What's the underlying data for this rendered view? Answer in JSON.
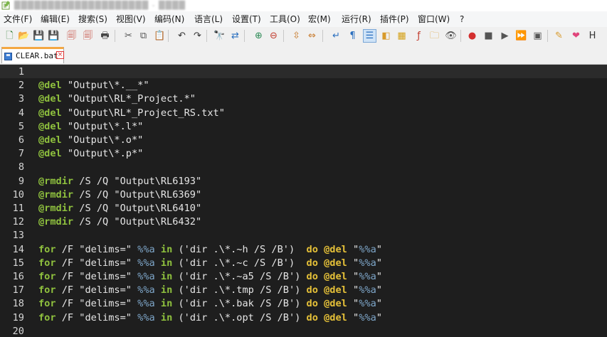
{
  "window": {
    "title": "████████████████████ - ████"
  },
  "menu": [
    {
      "label": "文件(F)"
    },
    {
      "label": "编辑(E)"
    },
    {
      "label": "搜索(S)"
    },
    {
      "label": "视图(V)"
    },
    {
      "label": "编码(N)"
    },
    {
      "label": "语言(L)"
    },
    {
      "label": "设置(T)"
    },
    {
      "label": "工具(O)"
    },
    {
      "label": "宏(M)"
    },
    {
      "label": "运行(R)"
    },
    {
      "label": "插件(P)"
    },
    {
      "label": "窗口(W)"
    },
    {
      "label": "?"
    }
  ],
  "toolbar": [
    {
      "name": "new-file-icon",
      "glyph": "🗋",
      "color": "#2e7d32"
    },
    {
      "name": "open-file-icon",
      "glyph": "📂",
      "color": "#d89a2b"
    },
    {
      "name": "save-icon",
      "glyph": "💾",
      "color": "#3f6fb5"
    },
    {
      "name": "save-all-icon",
      "glyph": "💾",
      "color": "#3f6fb5"
    },
    {
      "name": "close-file-icon",
      "glyph": "🗐",
      "color": "#c0392b"
    },
    {
      "name": "close-all-icon",
      "glyph": "🗐",
      "color": "#c0392b"
    },
    {
      "name": "print-icon",
      "glyph": "🖶",
      "color": "#444444"
    },
    {
      "name": "cut-icon",
      "glyph": "✂",
      "color": "#555555"
    },
    {
      "name": "copy-icon",
      "glyph": "⧉",
      "color": "#555555"
    },
    {
      "name": "paste-icon",
      "glyph": "📋",
      "color": "#8a6d3b"
    },
    {
      "name": "undo-icon",
      "glyph": "↶",
      "color": "#333333"
    },
    {
      "name": "redo-icon",
      "glyph": "↷",
      "color": "#333333"
    },
    {
      "name": "find-icon",
      "glyph": "🔭",
      "color": "#333333"
    },
    {
      "name": "replace-icon",
      "glyph": "⇄",
      "color": "#2a6fbf"
    },
    {
      "name": "zoom-in-icon",
      "glyph": "⊕",
      "color": "#2e8b57"
    },
    {
      "name": "zoom-out-icon",
      "glyph": "⊖",
      "color": "#c0392b"
    },
    {
      "name": "sync-vertical-icon",
      "glyph": "⇳",
      "color": "#c77a2b"
    },
    {
      "name": "sync-horizontal-icon",
      "glyph": "⇔",
      "color": "#c77a2b"
    },
    {
      "name": "word-wrap-icon",
      "glyph": "↵",
      "color": "#2a6fbf"
    },
    {
      "name": "show-all-chars-icon",
      "glyph": "¶",
      "color": "#2a6fbf"
    },
    {
      "name": "indent-guide-icon",
      "glyph": "☰",
      "color": "#2a6fbf"
    },
    {
      "name": "user-language-icon",
      "glyph": "◧",
      "color": "#d89a2b"
    },
    {
      "name": "document-map-icon",
      "glyph": "▦",
      "color": "#d4a017"
    },
    {
      "name": "function-list-icon",
      "glyph": "ƒ",
      "color": "#c0392b"
    },
    {
      "name": "folder-workspace-icon",
      "glyph": "🗀",
      "color": "#d89a2b"
    },
    {
      "name": "monitoring-icon",
      "glyph": "👁",
      "color": "#555555"
    },
    {
      "name": "record-macro-icon",
      "glyph": "●",
      "color": "#d32f2f"
    },
    {
      "name": "stop-record-icon",
      "glyph": "■",
      "color": "#555555"
    },
    {
      "name": "play-macro-icon",
      "glyph": "▶",
      "color": "#555555"
    },
    {
      "name": "run-macro-multiple-icon",
      "glyph": "⏩",
      "color": "#2a6fbf"
    },
    {
      "name": "save-macro-icon",
      "glyph": "▣",
      "color": "#555555"
    },
    {
      "name": "spell-check-icon",
      "glyph": "✎",
      "color": "#d89a2b"
    },
    {
      "name": "favorite-icon",
      "glyph": "❤",
      "color": "#e0457b"
    },
    {
      "name": "hex-editor-icon",
      "glyph": "H",
      "color": "#333333"
    }
  ],
  "tab": {
    "label": "CLEAR.bat",
    "close": "×"
  },
  "editor": {
    "current_line": 1,
    "lines": [
      {
        "n": "1",
        "tokens": []
      },
      {
        "n": "2",
        "tokens": [
          {
            "t": "@del",
            "c": "kw"
          },
          {
            "t": " \"Output\\*.__*\"",
            "c": "str"
          }
        ]
      },
      {
        "n": "3",
        "tokens": [
          {
            "t": "@del",
            "c": "kw"
          },
          {
            "t": " \"Output\\RL*_Project.*\"",
            "c": "str"
          }
        ]
      },
      {
        "n": "4",
        "tokens": [
          {
            "t": "@del",
            "c": "kw"
          },
          {
            "t": " \"Output\\RL*_Project_RS.txt\"",
            "c": "str"
          }
        ]
      },
      {
        "n": "5",
        "tokens": [
          {
            "t": "@del",
            "c": "kw"
          },
          {
            "t": " \"Output\\*.l*\"",
            "c": "str"
          }
        ]
      },
      {
        "n": "6",
        "tokens": [
          {
            "t": "@del",
            "c": "kw"
          },
          {
            "t": " \"Output\\*.o*\"",
            "c": "str"
          }
        ]
      },
      {
        "n": "7",
        "tokens": [
          {
            "t": "@del",
            "c": "kw"
          },
          {
            "t": " \"Output\\*.p*\"",
            "c": "str"
          }
        ]
      },
      {
        "n": "8",
        "tokens": []
      },
      {
        "n": "9",
        "tokens": [
          {
            "t": "@rmdir",
            "c": "kw"
          },
          {
            "t": " /S /Q \"Output\\RL6193\"",
            "c": "str"
          }
        ]
      },
      {
        "n": "10",
        "tokens": [
          {
            "t": "@rmdir",
            "c": "kw"
          },
          {
            "t": " /S /Q \"Output\\RL6369\"",
            "c": "str"
          }
        ]
      },
      {
        "n": "11",
        "tokens": [
          {
            "t": "@rmdir",
            "c": "kw"
          },
          {
            "t": " /S /Q \"Output\\RL6410\"",
            "c": "str"
          }
        ]
      },
      {
        "n": "12",
        "tokens": [
          {
            "t": "@rmdir",
            "c": "kw"
          },
          {
            "t": " /S /Q \"Output\\RL6432\"",
            "c": "str"
          }
        ]
      },
      {
        "n": "13",
        "tokens": []
      },
      {
        "n": "14",
        "tokens": [
          {
            "t": "for",
            "c": "kw"
          },
          {
            "t": " /F \"delims=\" ",
            "c": "str"
          },
          {
            "t": "%%a",
            "c": "var"
          },
          {
            "t": " ",
            "c": "str"
          },
          {
            "t": "in",
            "c": "kw"
          },
          {
            "t": " ('dir .\\*.~h /S /B')  ",
            "c": "str"
          },
          {
            "t": "do",
            "c": "kw2"
          },
          {
            "t": " ",
            "c": "str"
          },
          {
            "t": "@del",
            "c": "kw2"
          },
          {
            "t": " \"",
            "c": "str"
          },
          {
            "t": "%%a",
            "c": "var"
          },
          {
            "t": "\"",
            "c": "str"
          }
        ]
      },
      {
        "n": "15",
        "tokens": [
          {
            "t": "for",
            "c": "kw"
          },
          {
            "t": " /F \"delims=\" ",
            "c": "str"
          },
          {
            "t": "%%a",
            "c": "var"
          },
          {
            "t": " ",
            "c": "str"
          },
          {
            "t": "in",
            "c": "kw"
          },
          {
            "t": " ('dir .\\*.~c /S /B')  ",
            "c": "str"
          },
          {
            "t": "do",
            "c": "kw2"
          },
          {
            "t": " ",
            "c": "str"
          },
          {
            "t": "@del",
            "c": "kw2"
          },
          {
            "t": " \"",
            "c": "str"
          },
          {
            "t": "%%a",
            "c": "var"
          },
          {
            "t": "\"",
            "c": "str"
          }
        ]
      },
      {
        "n": "16",
        "tokens": [
          {
            "t": "for",
            "c": "kw"
          },
          {
            "t": " /F \"delims=\" ",
            "c": "str"
          },
          {
            "t": "%%a",
            "c": "var"
          },
          {
            "t": " ",
            "c": "str"
          },
          {
            "t": "in",
            "c": "kw"
          },
          {
            "t": " ('dir .\\*.~a5 /S /B') ",
            "c": "str"
          },
          {
            "t": "do",
            "c": "kw2"
          },
          {
            "t": " ",
            "c": "str"
          },
          {
            "t": "@del",
            "c": "kw2"
          },
          {
            "t": " \"",
            "c": "str"
          },
          {
            "t": "%%a",
            "c": "var"
          },
          {
            "t": "\"",
            "c": "str"
          }
        ]
      },
      {
        "n": "17",
        "tokens": [
          {
            "t": "for",
            "c": "kw"
          },
          {
            "t": " /F \"delims=\" ",
            "c": "str"
          },
          {
            "t": "%%a",
            "c": "var"
          },
          {
            "t": " ",
            "c": "str"
          },
          {
            "t": "in",
            "c": "kw"
          },
          {
            "t": " ('dir .\\*.tmp /S /B') ",
            "c": "str"
          },
          {
            "t": "do",
            "c": "kw2"
          },
          {
            "t": " ",
            "c": "str"
          },
          {
            "t": "@del",
            "c": "kw2"
          },
          {
            "t": " \"",
            "c": "str"
          },
          {
            "t": "%%a",
            "c": "var"
          },
          {
            "t": "\"",
            "c": "str"
          }
        ]
      },
      {
        "n": "18",
        "tokens": [
          {
            "t": "for",
            "c": "kw"
          },
          {
            "t": " /F \"delims=\" ",
            "c": "str"
          },
          {
            "t": "%%a",
            "c": "var"
          },
          {
            "t": " ",
            "c": "str"
          },
          {
            "t": "in",
            "c": "kw"
          },
          {
            "t": " ('dir .\\*.bak /S /B') ",
            "c": "str"
          },
          {
            "t": "do",
            "c": "kw2"
          },
          {
            "t": " ",
            "c": "str"
          },
          {
            "t": "@del",
            "c": "kw2"
          },
          {
            "t": " \"",
            "c": "str"
          },
          {
            "t": "%%a",
            "c": "var"
          },
          {
            "t": "\"",
            "c": "str"
          }
        ]
      },
      {
        "n": "19",
        "tokens": [
          {
            "t": "for",
            "c": "kw"
          },
          {
            "t": " /F \"delims=\" ",
            "c": "str"
          },
          {
            "t": "%%a",
            "c": "var"
          },
          {
            "t": " ",
            "c": "str"
          },
          {
            "t": "in",
            "c": "kw"
          },
          {
            "t": " ('dir .\\*.opt /S /B') ",
            "c": "str"
          },
          {
            "t": "do",
            "c": "kw2"
          },
          {
            "t": " ",
            "c": "str"
          },
          {
            "t": "@del",
            "c": "kw2"
          },
          {
            "t": " \"",
            "c": "str"
          },
          {
            "t": "%%a",
            "c": "var"
          },
          {
            "t": "\"",
            "c": "str"
          }
        ]
      },
      {
        "n": "20",
        "tokens": []
      }
    ]
  }
}
